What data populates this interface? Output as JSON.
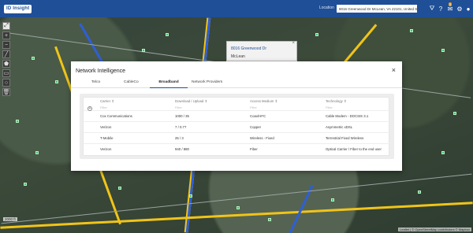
{
  "header": {
    "logo_text": "ID Insight",
    "location_label": "Location",
    "location_value": "8016 Greenwood Dr McLean, VA 22101, United States",
    "notification_count": "2",
    "icons": [
      "filter-icon",
      "help-icon",
      "notifications-icon",
      "settings-icon",
      "user-icon"
    ]
  },
  "map": {
    "scale_text": "2000 ft",
    "attribution": "Leaflet | © OpenStreetMap contributors © Mapbox"
  },
  "popup": {
    "address": "8016 Greenwood Dr",
    "city": "McLean"
  },
  "modal": {
    "title": "Network Intelligence",
    "close_label": "×",
    "tabs": [
      {
        "label": "Telco",
        "active": false
      },
      {
        "label": "CableCo",
        "active": false
      },
      {
        "label": "Broadband",
        "active": true
      },
      {
        "label": "Network Providers",
        "active": false
      }
    ],
    "table": {
      "headers": [
        "Carrier",
        "Download / Upload",
        "Access Medium",
        "Technology"
      ],
      "filter_placeholder": "Filter",
      "rows": [
        [
          "Cox Communications",
          "1000 / 35",
          "Coax/HFC",
          "Cable Modem - DOCSIS 3.1"
        ],
        [
          "Verizon",
          "7 / 0.77",
          "Copper",
          "Asymmetric xDSL"
        ],
        [
          "T-Mobile",
          "25 / 3",
          "Wireless - Fixed",
          "Terrestrial Fixed Wireless"
        ],
        [
          "Verizon",
          "940 / 880",
          "Fiber",
          "Optical Carrier / Fiber to the end user"
        ]
      ]
    }
  }
}
